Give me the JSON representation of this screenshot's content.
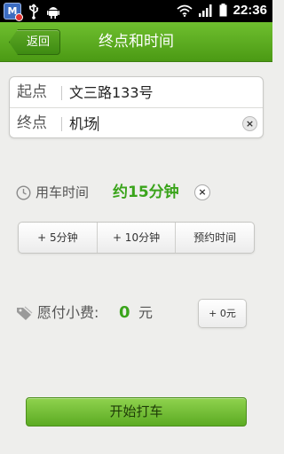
{
  "status_bar": {
    "app_badge": "M",
    "time": "22:36"
  },
  "header": {
    "back_label": "返回",
    "title": "终点和时间"
  },
  "route": {
    "start_label": "起点",
    "start_value": "文三路133号",
    "end_label": "终点",
    "end_value": "机场",
    "clear_icon": "×"
  },
  "ride_time": {
    "label": "用车时间",
    "value": "约15分钟",
    "clear_icon": "×"
  },
  "time_options": [
    "+ 5分钟",
    "+ 10分钟",
    "预约时间"
  ],
  "tip": {
    "label": "愿付小费:",
    "amount": "0",
    "unit": "元",
    "add_button": "+ 0元"
  },
  "start_button": "开始打车",
  "colors": {
    "accent_green": "#3aa41b",
    "header_green": "#5cab23"
  }
}
